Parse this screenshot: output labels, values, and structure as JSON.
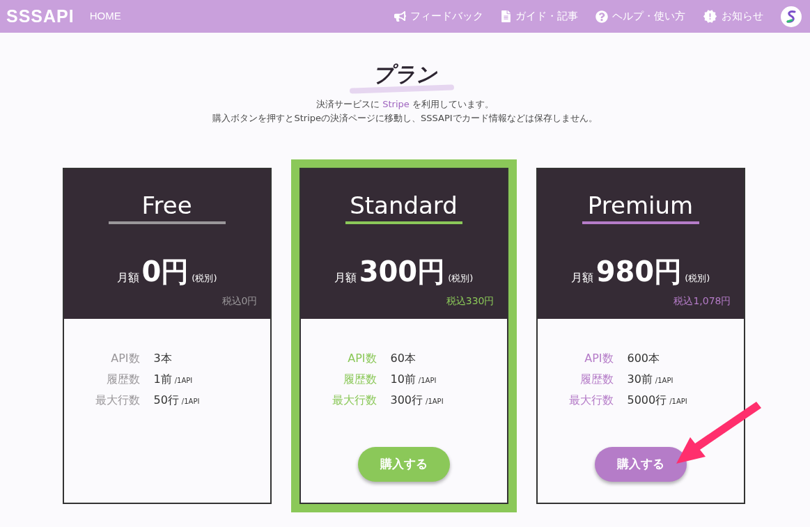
{
  "nav": {
    "logo": "SSSAPI",
    "home": "HOME",
    "items": [
      {
        "kind": "feedback",
        "label": "フィードバック"
      },
      {
        "kind": "guide",
        "label": "ガイド・記事"
      },
      {
        "kind": "help",
        "label": "ヘルプ・使い方"
      },
      {
        "kind": "news",
        "label": "お知らせ"
      }
    ]
  },
  "title": "プラン",
  "intro": [
    [
      {
        "kind": "text",
        "text": "決済サービスに "
      },
      {
        "kind": "link",
        "text": "Stripe"
      },
      {
        "kind": "text",
        "text": " を利用しています。"
      }
    ],
    [
      {
        "kind": "text",
        "text": "購入ボタンを押すとStripeの決済ページに移動し、SSSAPIでカード情報などは保存しません。"
      }
    ]
  ],
  "plans": [
    {
      "name": "Free",
      "color": "#9a979a",
      "selected": false,
      "monthly": "月額",
      "price": "0円",
      "tax_note": "(税別)",
      "tax_included": "税込0円",
      "features": [
        {
          "label": "API数",
          "value": "3本"
        },
        {
          "label": "履歴数",
          "value": "1前",
          "unit": "/1API"
        },
        {
          "label": "最大行数",
          "value": "50行",
          "unit": "/1API"
        }
      ]
    },
    {
      "name": "Standard",
      "color": "#8bc859",
      "selected": true,
      "monthly": "月額",
      "price": "300円",
      "tax_note": "(税別)",
      "tax_included": "税込330円",
      "features": [
        {
          "label": "API数",
          "value": "60本"
        },
        {
          "label": "履歴数",
          "value": "10前",
          "unit": "/1API"
        },
        {
          "label": "最大行数",
          "value": "300行",
          "unit": "/1API"
        }
      ],
      "button": "購入する"
    },
    {
      "name": "Premium",
      "color": "#b57cc8",
      "selected": false,
      "monthly": "月額",
      "price": "980円",
      "tax_note": "(税別)",
      "tax_included": "税込1,078円",
      "features": [
        {
          "label": "API数",
          "value": "600本"
        },
        {
          "label": "履歴数",
          "value": "30前",
          "unit": "/1API"
        },
        {
          "label": "最大行数",
          "value": "5000行",
          "unit": "/1API"
        }
      ],
      "button": "購入する"
    }
  ]
}
